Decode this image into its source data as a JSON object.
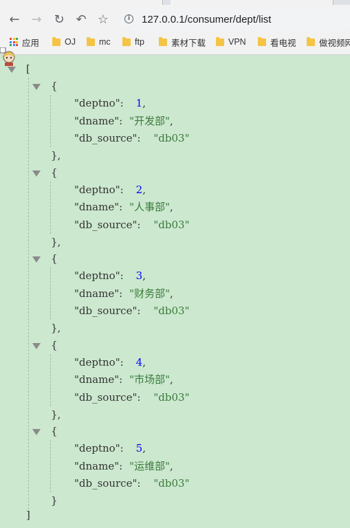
{
  "browser": {
    "url": "127.0.0.1/consumer/dept/list",
    "bookmarks": [
      "应用",
      "OJ",
      "mc",
      "ftp",
      "素材下载",
      "VPN",
      "看电视",
      "做视频网"
    ]
  },
  "json_viewer": {
    "open_bracket": "[",
    "close_bracket": "]",
    "open_brace": "{",
    "close_brace": "}",
    "close_brace_comma": "},",
    "keys": {
      "deptno": "\"deptno\":",
      "dname": "\"dname\":",
      "db_source": "\"db_source\":"
    },
    "records": [
      {
        "deptno": "1",
        "dname": "\"开发部\"",
        "db_source": "\"db03\""
      },
      {
        "deptno": "2",
        "dname": "\"人事部\"",
        "db_source": "\"db03\""
      },
      {
        "deptno": "3",
        "dname": "\"财务部\"",
        "db_source": "\"db03\""
      },
      {
        "deptno": "4",
        "dname": "\"市场部\"",
        "db_source": "\"db03\""
      },
      {
        "deptno": "5",
        "dname": "\"运维部\"",
        "db_source": "\"db03\""
      }
    ]
  }
}
